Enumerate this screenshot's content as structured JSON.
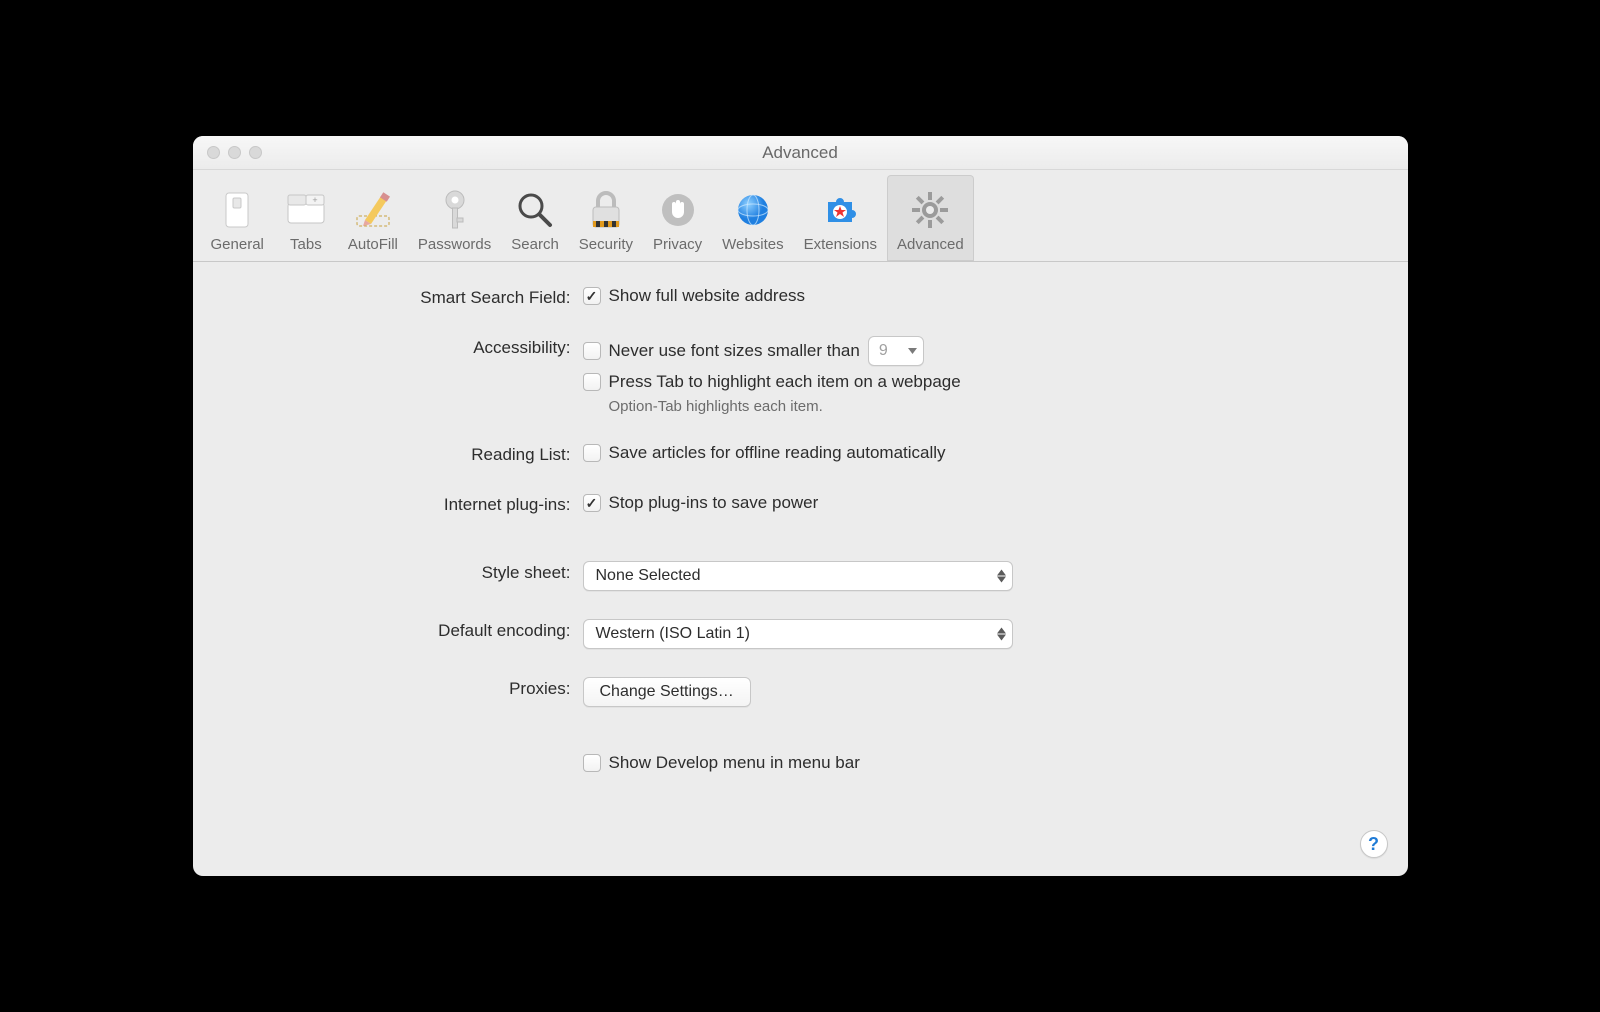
{
  "window": {
    "title": "Advanced"
  },
  "toolbar": {
    "items": [
      {
        "label": "General"
      },
      {
        "label": "Tabs"
      },
      {
        "label": "AutoFill"
      },
      {
        "label": "Passwords"
      },
      {
        "label": "Search"
      },
      {
        "label": "Security"
      },
      {
        "label": "Privacy"
      },
      {
        "label": "Websites"
      },
      {
        "label": "Extensions"
      },
      {
        "label": "Advanced"
      }
    ],
    "selected": "Advanced"
  },
  "sections": {
    "smart_search": {
      "label": "Smart Search Field:",
      "show_full_address": {
        "text": "Show full website address",
        "checked": true
      }
    },
    "accessibility": {
      "label": "Accessibility:",
      "min_font": {
        "text": "Never use font sizes smaller than",
        "checked": false,
        "value": "9"
      },
      "press_tab": {
        "text": "Press Tab to highlight each item on a webpage",
        "checked": false
      },
      "hint": "Option-Tab highlights each item."
    },
    "reading_list": {
      "label": "Reading List:",
      "save_offline": {
        "text": "Save articles for offline reading automatically",
        "checked": false
      }
    },
    "plugins": {
      "label": "Internet plug-ins:",
      "stop_plugins": {
        "text": "Stop plug-ins to save power",
        "checked": true
      }
    },
    "stylesheet": {
      "label": "Style sheet:",
      "value": "None Selected"
    },
    "encoding": {
      "label": "Default encoding:",
      "value": "Western (ISO Latin 1)"
    },
    "proxies": {
      "label": "Proxies:",
      "button": "Change Settings…"
    },
    "develop": {
      "text": "Show Develop menu in menu bar",
      "checked": false
    }
  },
  "help_glyph": "?"
}
